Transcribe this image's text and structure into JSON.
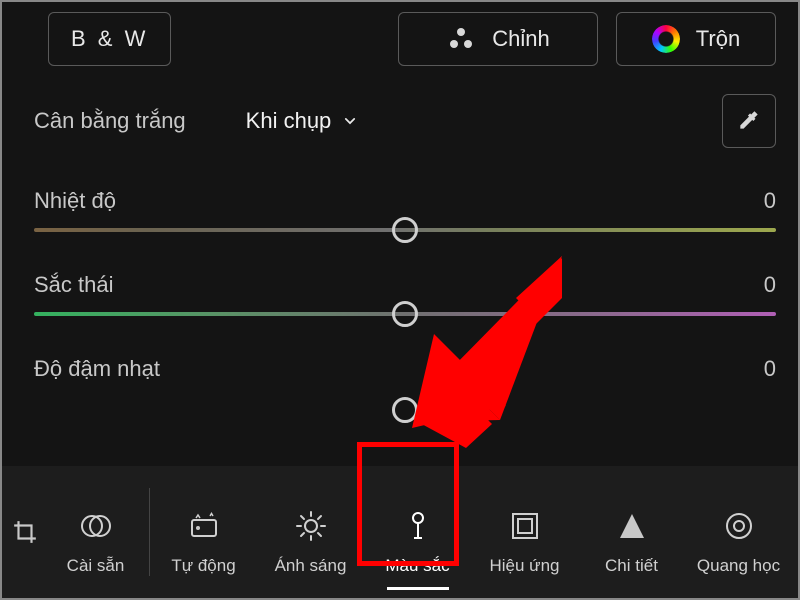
{
  "top": {
    "bw_label": "B & W",
    "profile_label": "Chỉnh",
    "mix_label": "Trộn"
  },
  "wb": {
    "label": "Cân bằng trắng",
    "dropdown": "Khi chụp"
  },
  "sliders": {
    "temp": {
      "label": "Nhiệt độ",
      "value": "0"
    },
    "tint": {
      "label": "Sắc thái",
      "value": "0"
    },
    "vibr": {
      "label": "Độ đậm nhạt",
      "value": "0"
    }
  },
  "toolbar": {
    "active_index": 3,
    "items": [
      {
        "label": "Cài sẵn",
        "icon": "presets-icon"
      },
      {
        "label": "Tự động",
        "icon": "auto-icon"
      },
      {
        "label": "Ánh sáng",
        "icon": "light-icon"
      },
      {
        "label": "Màu sắc",
        "icon": "color-icon"
      },
      {
        "label": "Hiệu ứng",
        "icon": "effects-icon"
      },
      {
        "label": "Chi tiết",
        "icon": "detail-icon"
      },
      {
        "label": "Quang học",
        "icon": "optics-icon"
      }
    ]
  }
}
